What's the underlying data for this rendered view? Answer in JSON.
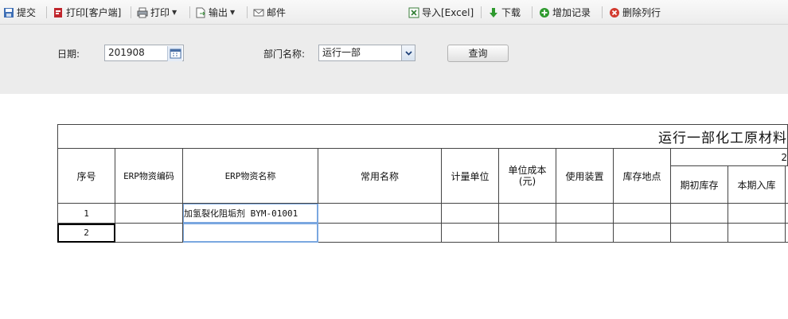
{
  "toolbar": {
    "submit": "提交",
    "print_client": "打印[客户端]",
    "print": "打印",
    "export": "输出",
    "mail": "邮件",
    "import_excel": "导入[Excel]",
    "download": "下载",
    "add_record": "增加记录",
    "delete_row": "删除列行"
  },
  "filters": {
    "date_label": "日期:",
    "date_value": "201908",
    "dept_label": "部门名称:",
    "dept_value": "运行一部",
    "query_label": "查询"
  },
  "sheet": {
    "title": "运行一部化工原材料",
    "group_header_partial": "2",
    "headers": {
      "seq": "序号",
      "erp_code": "ERP物资编码",
      "erp_name": "ERP物资名称",
      "common_name": "常用名称",
      "unit": "计量单位",
      "unit_cost": "单位成本(元)",
      "device": "使用装置",
      "location": "库存地点",
      "opening_stock": "期初库存",
      "period_in": "本期入库"
    },
    "rows": [
      {
        "seq": "1",
        "erp_code": "",
        "erp_name": "加氢裂化阻垢剂 BYM-01001",
        "common_name": "",
        "unit": "",
        "unit_cost": "",
        "device": "",
        "location": "",
        "opening_stock": "",
        "period_in": ""
      },
      {
        "seq": "2",
        "erp_code": "",
        "erp_name": "",
        "common_name": "",
        "unit": "",
        "unit_cost": "",
        "device": "",
        "location": "",
        "opening_stock": "",
        "period_in": ""
      }
    ]
  },
  "colors": {
    "toolbar_bg": "#ececec",
    "grid_line": "#444444",
    "active_cell_border": "#7aa7e0"
  }
}
